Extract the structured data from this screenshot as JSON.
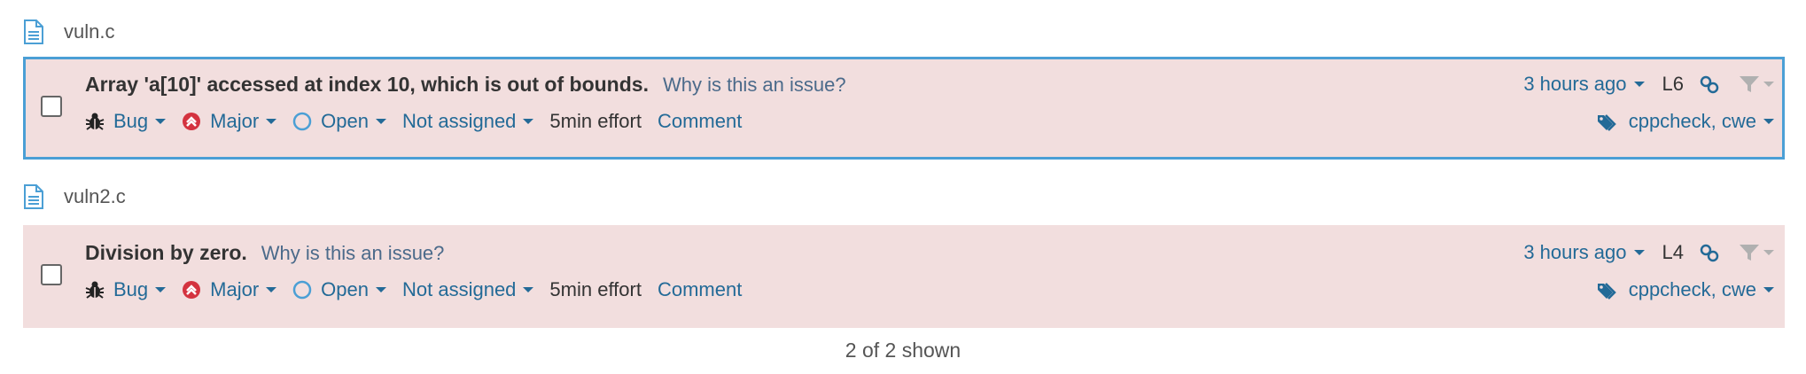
{
  "files": [
    {
      "name": "vuln.c",
      "issue": {
        "message": "Array 'a[10]' accessed at index 10, which is out of bounds.",
        "why_link": "Why is this an issue?",
        "type": "Bug",
        "severity": "Major",
        "status": "Open",
        "assignee": "Not assigned",
        "effort": "5min effort",
        "comment": "Comment",
        "time": "3 hours ago",
        "line": "L6",
        "tags": "cppcheck, cwe"
      }
    },
    {
      "name": "vuln2.c",
      "issue": {
        "message": "Division by zero.",
        "why_link": "Why is this an issue?",
        "type": "Bug",
        "severity": "Major",
        "status": "Open",
        "assignee": "Not assigned",
        "effort": "5min effort",
        "comment": "Comment",
        "time": "3 hours ago",
        "line": "L4",
        "tags": "cppcheck, cwe"
      }
    }
  ],
  "footer": {
    "shown": "2 of 2 shown"
  },
  "colors": {
    "issue_bg": "#f2dede",
    "selected_border": "#4b9fd5",
    "link": "#236a97",
    "severity_major": "#d4333f"
  },
  "icons": {
    "file": "file-icon",
    "type": "bug-icon",
    "severity": "major-severity-icon",
    "status": "open-status-icon",
    "permalink": "link-icon",
    "filter": "filter-icon",
    "tags": "tags-icon"
  }
}
